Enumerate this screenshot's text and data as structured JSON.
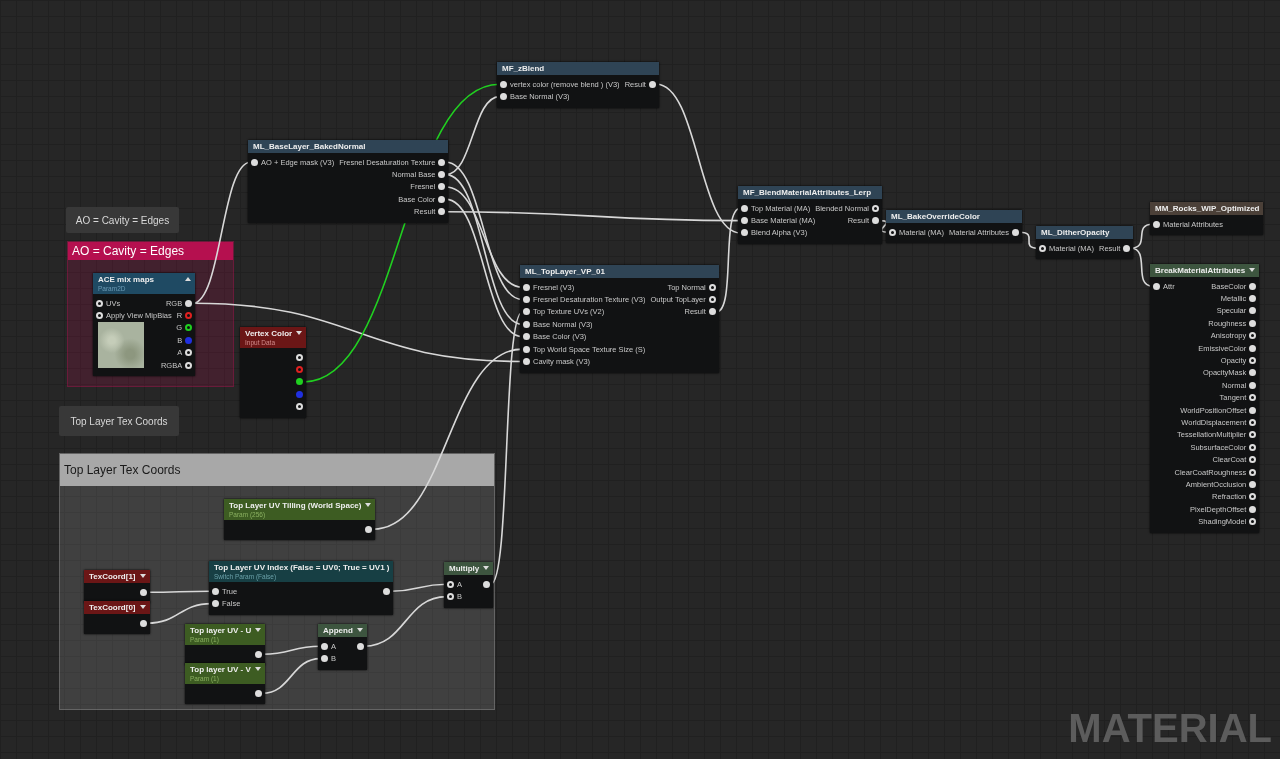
{
  "comments": [
    {
      "bubble": "AO = Cavity = Edges",
      "title": "AO = Cavity = Edges",
      "color": "#b5104f"
    },
    {
      "bubble": "Top Layer Tex Coords",
      "title": "Top Layer Tex Coords",
      "color": "#a8a8a8"
    }
  ],
  "nodes": [
    {
      "kind": "function",
      "title": "MF_zBlend",
      "rows": [
        {
          "input": {
            "label": "vertex color (remove blend ) (V3)",
            "filled": true
          },
          "output": {
            "label": "Result",
            "filled": true
          }
        },
        {
          "input": {
            "label": "Base Normal (V3)",
            "filled": true
          }
        }
      ]
    },
    {
      "kind": "function",
      "title": "ML_BaseLayer_BakedNormal",
      "rows": [
        {
          "input": {
            "label": "AO + Edge mask (V3)",
            "filled": true
          },
          "output": {
            "label": "Fresnel Desaturation Texture",
            "filled": true
          }
        },
        {
          "output": {
            "label": "Normal Base",
            "filled": true
          }
        },
        {
          "output": {
            "label": "Fresnel",
            "filled": true
          }
        },
        {
          "output": {
            "label": "Base Color",
            "filled": true
          }
        },
        {
          "output": {
            "label": "Result",
            "filled": true
          }
        }
      ]
    },
    {
      "kind": "function",
      "title": "MF_BlendMaterialAttributes_Lerp",
      "rows": [
        {
          "input": {
            "label": "Top Material (MA)",
            "filled": true
          },
          "output": {
            "label": "Blended Normal",
            "filled": false
          }
        },
        {
          "input": {
            "label": "Base Material (MA)",
            "filled": true
          },
          "output": {
            "label": "Result",
            "filled": true
          }
        },
        {
          "input": {
            "label": "Blend Alpha (V3)",
            "filled": true
          }
        }
      ]
    },
    {
      "kind": "function",
      "title": "ML_BakeOverrideColor",
      "rows": [
        {
          "input": {
            "label": "Material (MA)",
            "filled": false
          },
          "output": {
            "label": "Material Attributes",
            "filled": true
          }
        }
      ]
    },
    {
      "kind": "result",
      "title": "MM_Rocks_WIP_Optimized",
      "rows": [
        {
          "input": {
            "label": "Material Attributes",
            "filled": true
          }
        }
      ]
    },
    {
      "kind": "function",
      "title": "ML_DitherOpacity",
      "rows": [
        {
          "input": {
            "label": "Material (MA)",
            "filled": false
          },
          "output": {
            "label": "Result",
            "filled": true
          }
        }
      ]
    },
    {
      "kind": "texture",
      "title": "ACE mix maps",
      "subtitle": "Param2D",
      "expanded": true,
      "rows": [
        {
          "input": {
            "label": "UVs",
            "filled": false
          },
          "output": {
            "label": "RGB",
            "filled": true
          }
        },
        {
          "input": {
            "label": "Apply View MipBias",
            "filled": false
          },
          "output": {
            "label": "R",
            "filled": false,
            "color": "#e02020"
          }
        },
        {
          "output": {
            "label": "G",
            "filled": false,
            "color": "#20d020"
          }
        },
        {
          "output": {
            "label": "B",
            "filled": true,
            "color": "#2030e0"
          }
        },
        {
          "output": {
            "label": "A",
            "filled": false
          }
        },
        {
          "output": {
            "label": "RGBA",
            "filled": false
          }
        }
      ]
    },
    {
      "kind": "function",
      "title": "ML_TopLayer_VP_01",
      "rows": [
        {
          "input": {
            "label": "Fresnel (V3)",
            "filled": true
          },
          "output": {
            "label": "Top Normal",
            "filled": false
          }
        },
        {
          "input": {
            "label": "Fresnel Desaturation Texture (V3)",
            "filled": true
          },
          "output": {
            "label": "Output TopLayer",
            "filled": false
          }
        },
        {
          "input": {
            "label": "Top Texture UVs (V2)",
            "filled": true
          },
          "output": {
            "label": "Result",
            "filled": true
          }
        },
        {
          "input": {
            "label": "Base Normal (V3)",
            "filled": true
          }
        },
        {
          "input": {
            "label": "Base Color (V3)",
            "filled": true
          }
        },
        {
          "input": {
            "label": "Top World Space Texture Size (S)",
            "filled": true
          }
        },
        {
          "input": {
            "label": "Cavity mask (V3)",
            "filled": true
          }
        }
      ]
    },
    {
      "kind": "math",
      "title": "BreakMaterialAttributes",
      "expanded": false,
      "rows": [
        {
          "input": {
            "label": "Attr",
            "filled": true
          },
          "output": {
            "label": "BaseColor",
            "filled": true
          }
        },
        {
          "output": {
            "label": "Metallic",
            "filled": true
          }
        },
        {
          "output": {
            "label": "Specular",
            "filled": true
          }
        },
        {
          "output": {
            "label": "Roughness",
            "filled": true
          }
        },
        {
          "output": {
            "label": "Anisotropy",
            "filled": false
          }
        },
        {
          "output": {
            "label": "EmissiveColor",
            "filled": true
          }
        },
        {
          "output": {
            "label": "Opacity",
            "filled": false
          }
        },
        {
          "output": {
            "label": "OpacityMask",
            "filled": true
          }
        },
        {
          "output": {
            "label": "Normal",
            "filled": true
          }
        },
        {
          "output": {
            "label": "Tangent",
            "filled": false
          }
        },
        {
          "output": {
            "label": "WorldPositionOffset",
            "filled": true
          }
        },
        {
          "output": {
            "label": "WorldDisplacement",
            "filled": false
          }
        },
        {
          "output": {
            "label": "TessellationMultiplier",
            "filled": false
          }
        },
        {
          "output": {
            "label": "SubsurfaceColor",
            "filled": false
          }
        },
        {
          "output": {
            "label": "ClearCoat",
            "filled": false
          }
        },
        {
          "output": {
            "label": "ClearCoatRoughness",
            "filled": false
          }
        },
        {
          "output": {
            "label": "AmbientOcclusion",
            "filled": true
          }
        },
        {
          "output": {
            "label": "Refraction",
            "filled": false
          }
        },
        {
          "output": {
            "label": "PixelDepthOffset",
            "filled": true
          }
        },
        {
          "output": {
            "label": "ShadingModel",
            "filled": false
          }
        }
      ]
    },
    {
      "kind": "input",
      "title": "Vertex Color",
      "subtitle": "Input Data",
      "expanded": false,
      "rows": [
        {
          "output": {
            "filled": false
          }
        },
        {
          "output": {
            "filled": false,
            "color": "#e02020"
          }
        },
        {
          "output": {
            "filled": true,
            "color": "#20d020"
          }
        },
        {
          "output": {
            "filled": true,
            "color": "#2030e0"
          }
        },
        {
          "output": {
            "filled": false
          }
        }
      ]
    },
    {
      "kind": "vector",
      "title": "Top Layer UV Tilling (World Space)",
      "subtitle": "Param (256)",
      "expanded": false,
      "rows": [
        {
          "output": {
            "filled": true
          }
        }
      ]
    },
    {
      "kind": "switch",
      "title": "Top Layer UV Index (False = UV0; True = UV1 )",
      "subtitle": "Switch Param (False)",
      "rows": [
        {
          "input": {
            "label": "True",
            "filled": true
          },
          "output": {
            "filled": true
          }
        },
        {
          "input": {
            "label": "False",
            "filled": true
          }
        }
      ]
    },
    {
      "kind": "math",
      "title": "Multiply",
      "expanded": false,
      "rows": [
        {
          "input": {
            "label": "A",
            "filled": false
          },
          "output": {
            "filled": true
          }
        },
        {
          "input": {
            "label": "B",
            "filled": false
          }
        }
      ]
    },
    {
      "kind": "input",
      "title": "TexCoord[1]",
      "expanded": false,
      "rows": [
        {
          "output": {
            "filled": true
          }
        }
      ]
    },
    {
      "kind": "input",
      "title": "TexCoord[0]",
      "expanded": false,
      "rows": [
        {
          "output": {
            "filled": true
          }
        }
      ]
    },
    {
      "kind": "vector",
      "title": "Top layer UV - U",
      "subtitle": "Param (1)",
      "expanded": false,
      "rows": [
        {
          "output": {
            "filled": true
          }
        }
      ]
    },
    {
      "kind": "math",
      "title": "Append",
      "expanded": false,
      "rows": [
        {
          "input": {
            "label": "A",
            "filled": true
          },
          "output": {
            "filled": true
          }
        },
        {
          "input": {
            "label": "B",
            "filled": true
          }
        }
      ]
    },
    {
      "kind": "vector",
      "title": "Top layer UV - V",
      "subtitle": "Param (1)",
      "expanded": false,
      "rows": [
        {
          "output": {
            "filled": true
          }
        }
      ]
    }
  ],
  "graph_label": "MATERIAL"
}
